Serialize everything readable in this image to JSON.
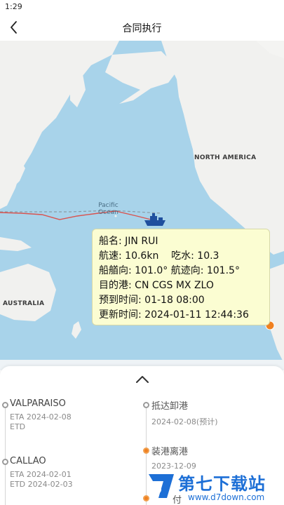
{
  "status_bar": {
    "time": "1:29"
  },
  "header": {
    "title": "合同执行"
  },
  "map": {
    "labels": {
      "north_america": "NORTH AMERICA",
      "australia": "AUSTRALIA",
      "ocean_line1": "Pacific",
      "ocean_line2": "Ocean"
    },
    "colors": {
      "water": "#a8d3ea",
      "land": "#f1f1ef",
      "route": "#d9534f",
      "vessel": "#1f4f9e",
      "port_marker": "#f08020"
    }
  },
  "info_card": {
    "ship_name": "船名: JIN RUI",
    "speed_draft": "航速: 10.6kn    吃水: 10.3",
    "heading_course": "船艏向: 101.0° 航迹向: 101.5°",
    "destination": "目的港: CN CGS MX ZLO",
    "eta": "预到时间: 01-18 08:00",
    "updated": "更新时间: 2024-01-11 12:44:36"
  },
  "ports": [
    {
      "name": "VALPARAISO",
      "eta": "ETA 2024-02-08",
      "etd": "ETD"
    },
    {
      "name": "CALLAO",
      "eta": "ETA 2024-02-01",
      "etd": "ETD 2024-02-03"
    }
  ],
  "steps": [
    {
      "name": "抵达卸港",
      "date": "2024-02-08(预计)"
    },
    {
      "name": "装港离港",
      "date": "2023-12-09"
    },
    {
      "name": "付"
    }
  ],
  "watermark": {
    "text": "第七下载站",
    "url": "www.d7down.com"
  }
}
